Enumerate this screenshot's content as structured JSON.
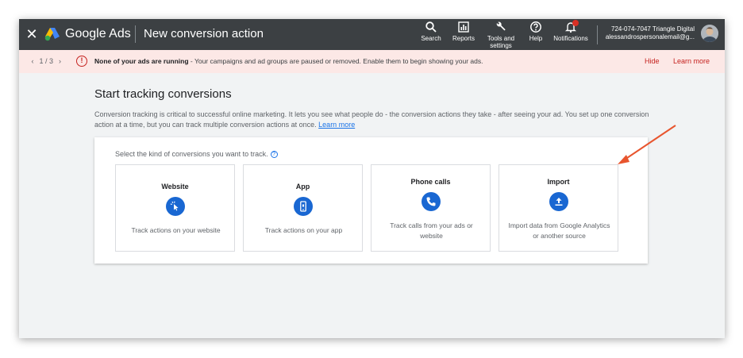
{
  "header": {
    "close_glyph": "✕",
    "brand": "Google Ads",
    "title": "New conversion action",
    "tools": [
      {
        "label": "Search",
        "icon": "search-icon"
      },
      {
        "label": "Reports",
        "icon": "bar-chart-icon"
      },
      {
        "label": "Tools and settings",
        "icon": "wrench-icon"
      },
      {
        "label": "Help",
        "icon": "help-icon"
      },
      {
        "label": "Notifications",
        "icon": "bell-icon"
      }
    ],
    "account_line1": "724-074-7047 Triangle Digital",
    "account_line2": "alessandrospersonalemail@g..."
  },
  "banner": {
    "pager": "1 / 3",
    "headline": "None of your ads are running",
    "message": " - Your campaigns and ad groups are paused or removed. Enable them to begin showing your ads.",
    "hide": "Hide",
    "learn_more": "Learn more"
  },
  "main": {
    "heading": "Start tracking conversions",
    "description": "Conversion tracking is critical to successful online marketing. It lets you see what people do - the conversion actions they take - after seeing your ad. You set up one conversion action at a time, but you can track multiple conversion actions at once.",
    "learn_more": "Learn more",
    "prompt": "Select the kind of conversions you want to track.",
    "options": [
      {
        "title": "Website",
        "desc": "Track actions on your website",
        "icon": "cursor-click-icon"
      },
      {
        "title": "App",
        "desc": "Track actions on your app",
        "icon": "phone-app-icon"
      },
      {
        "title": "Phone calls",
        "desc": "Track calls from your ads or website",
        "icon": "phone-icon"
      },
      {
        "title": "Import",
        "desc": "Import data from Google Analytics or another source",
        "icon": "upload-icon"
      }
    ]
  },
  "colors": {
    "topbar": "#3c4043",
    "banner_bg": "#fce8e6",
    "alert": "#c5221f",
    "accent": "#1a73e8",
    "icon_circle": "#1967d2",
    "arrow": "#e8552e"
  }
}
